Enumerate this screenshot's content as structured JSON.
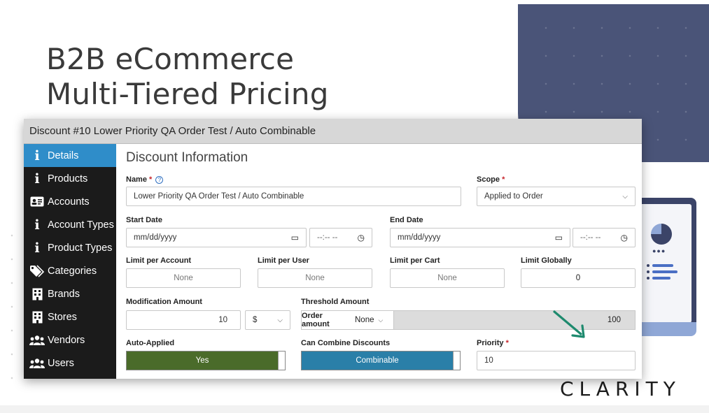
{
  "slide": {
    "headline_line1": "B2B eCommerce",
    "headline_line2": "Multi-Tiered Pricing",
    "brand": "CLARITY",
    "accent_navy": "#4a5478"
  },
  "window": {
    "title": "Discount #10 Lower Priority QA Order Test / Auto Combinable"
  },
  "sidebar": {
    "active_color": "#2f8dc9",
    "items": [
      {
        "label": "Details",
        "icon": "info-icon",
        "active": true
      },
      {
        "label": "Products",
        "icon": "info-icon"
      },
      {
        "label": "Accounts",
        "icon": "id-card-icon"
      },
      {
        "label": "Account Types",
        "icon": "info-icon"
      },
      {
        "label": "Product Types",
        "icon": "info-icon"
      },
      {
        "label": "Categories",
        "icon": "tag-icon"
      },
      {
        "label": "Brands",
        "icon": "building-icon"
      },
      {
        "label": "Stores",
        "icon": "building-icon"
      },
      {
        "label": "Vendors",
        "icon": "users-icon"
      },
      {
        "label": "Users",
        "icon": "users-icon"
      }
    ]
  },
  "form": {
    "section_title": "Discount Information",
    "name_label": "Name",
    "name_value": "Lower Priority QA Order Test / Auto Combinable",
    "scope_label": "Scope",
    "scope_value": "Applied to Order",
    "start_date_label": "Start Date",
    "start_date_placeholder": "mm/dd/yyyy",
    "start_time_placeholder": "--:-- --",
    "end_date_label": "End Date",
    "end_date_placeholder": "mm/dd/yyyy",
    "end_time_placeholder": "--:-- --",
    "limit_account_label": "Limit per Account",
    "limit_account_value": "None",
    "limit_user_label": "Limit per User",
    "limit_user_value": "None",
    "limit_cart_label": "Limit per Cart",
    "limit_cart_value": "None",
    "limit_global_label": "Limit Globally",
    "limit_global_value": "0",
    "mod_amount_label": "Modification Amount",
    "mod_amount_value": "10",
    "mod_unit_value": "$",
    "threshold_label": "Threshold Amount",
    "threshold_type_label": "Order amount",
    "threshold_select_value": "None",
    "threshold_value": "100",
    "auto_applied_label": "Auto-Applied",
    "auto_applied_value": "Yes",
    "auto_applied_color": "#4a6b2a",
    "combine_label": "Can Combine Discounts",
    "combine_value": "Combinable",
    "combine_color": "#2a7fa8",
    "priority_label": "Priority",
    "priority_value": "10",
    "required_mark": "*",
    "help_glyph": "?"
  }
}
